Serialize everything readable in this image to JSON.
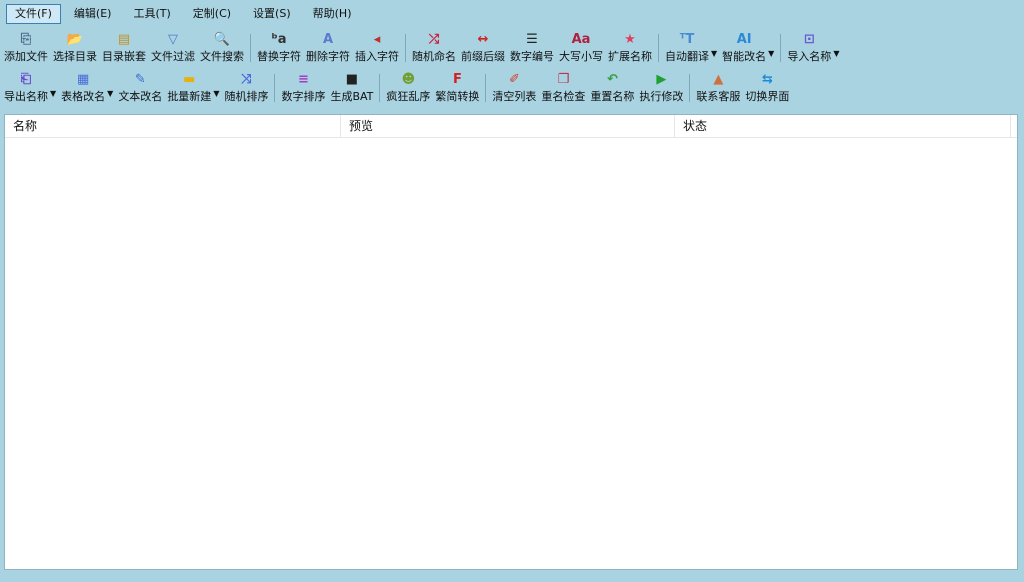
{
  "menu": [
    {
      "label": "文件(F)",
      "active": true
    },
    {
      "label": "编辑(E)"
    },
    {
      "label": "工具(T)"
    },
    {
      "label": "定制(C)"
    },
    {
      "label": "设置(S)"
    },
    {
      "label": "帮助(H)"
    }
  ],
  "toolbar_row1": [
    {
      "label": "添加文件",
      "icon": "add-file-icon",
      "glyph": "⎘",
      "color": "#4a6a8a"
    },
    {
      "label": "选择目录",
      "icon": "folder-open-icon",
      "glyph": "📂",
      "color": "#e0a020"
    },
    {
      "label": "目录嵌套",
      "icon": "nested-folder-icon",
      "glyph": "▤",
      "color": "#c89020"
    },
    {
      "label": "文件过滤",
      "icon": "filter-icon",
      "glyph": "▽",
      "color": "#4a7bd1"
    },
    {
      "label": "文件搜索",
      "icon": "search-icon",
      "glyph": "🔍",
      "color": "#6a8aa0"
    },
    {
      "sep": true
    },
    {
      "label": "替换字符",
      "icon": "replace-text-icon",
      "glyph": "ᵇa",
      "color": "#333"
    },
    {
      "label": "删除字符",
      "icon": "delete-text-icon",
      "glyph": "A",
      "color": "#5a7ad0"
    },
    {
      "label": "插入字符",
      "icon": "insert-text-icon",
      "glyph": "◂",
      "color": "#c03030"
    },
    {
      "sep": true
    },
    {
      "label": "随机命名",
      "icon": "shuffle-icon",
      "glyph": "⤮",
      "color": "#d02040"
    },
    {
      "label": "前缀后缀",
      "icon": "arrows-horizontal-icon",
      "glyph": "↔",
      "color": "#d02020"
    },
    {
      "label": "数字编号",
      "icon": "numbered-list-icon",
      "glyph": "☰",
      "color": "#222"
    },
    {
      "label": "大写小写",
      "icon": "letter-case-icon",
      "glyph": "Aa",
      "color": "#b02040"
    },
    {
      "label": "扩展名称",
      "icon": "star-icon",
      "glyph": "★",
      "color": "#e04060"
    },
    {
      "sep": true
    },
    {
      "label": "自动翻译",
      "icon": "translate-icon",
      "glyph": "ᵀT",
      "color": "#4a8ad0",
      "dropdown": true
    },
    {
      "label": "智能改名",
      "icon": "ai-icon",
      "glyph": "AI",
      "color": "#2a8ad8",
      "dropdown": true
    },
    {
      "sep": true
    },
    {
      "label": "导入名称",
      "icon": "import-icon",
      "glyph": "⊡",
      "color": "#6a5ad0",
      "dropdown": true
    }
  ],
  "toolbar_row2": [
    {
      "label": "导出名称",
      "icon": "export-icon",
      "glyph": "⎗",
      "color": "#6a4ad0",
      "dropdown": true
    },
    {
      "label": "表格改名",
      "icon": "table-icon",
      "glyph": "▦",
      "color": "#4a6ad8",
      "dropdown": true
    },
    {
      "label": "文本改名",
      "icon": "edit-text-icon",
      "glyph": "✎",
      "color": "#3a6ad0"
    },
    {
      "label": "批量新建",
      "icon": "new-folder-icon",
      "glyph": "▬",
      "color": "#e8b010",
      "dropdown": true
    },
    {
      "label": "随机排序",
      "icon": "shuffle-sort-icon",
      "glyph": "⤨",
      "color": "#4a6ad8"
    },
    {
      "sep": true
    },
    {
      "label": "数字排序",
      "icon": "sort-lines-icon",
      "glyph": "≡",
      "color": "#a040c0"
    },
    {
      "label": "生成BAT",
      "icon": "terminal-icon",
      "glyph": "■",
      "color": "#222"
    },
    {
      "sep": true
    },
    {
      "label": "疯狂乱序",
      "icon": "crazy-face-icon",
      "glyph": "☻",
      "color": "#70a030"
    },
    {
      "label": "繁简转换",
      "icon": "font-convert-icon",
      "glyph": "F",
      "color": "#d02020"
    },
    {
      "sep": true
    },
    {
      "label": "清空列表",
      "icon": "broom-icon",
      "glyph": "✐",
      "color": "#d04020"
    },
    {
      "label": "重名检查",
      "icon": "duplicate-check-icon",
      "glyph": "❐",
      "color": "#c03050"
    },
    {
      "label": "重置名称",
      "icon": "undo-icon",
      "glyph": "↶",
      "color": "#30a040"
    },
    {
      "label": "执行修改",
      "icon": "play-icon",
      "glyph": "▶",
      "color": "#20a030"
    },
    {
      "sep": true
    },
    {
      "label": "联系客服",
      "icon": "customer-service-icon",
      "glyph": "▲",
      "color": "#d07040"
    },
    {
      "label": "切换界面",
      "icon": "switch-ui-icon",
      "glyph": "⇆",
      "color": "#1a8ad8"
    }
  ],
  "list": {
    "columns": [
      "名称",
      "预览",
      "状态"
    ]
  }
}
